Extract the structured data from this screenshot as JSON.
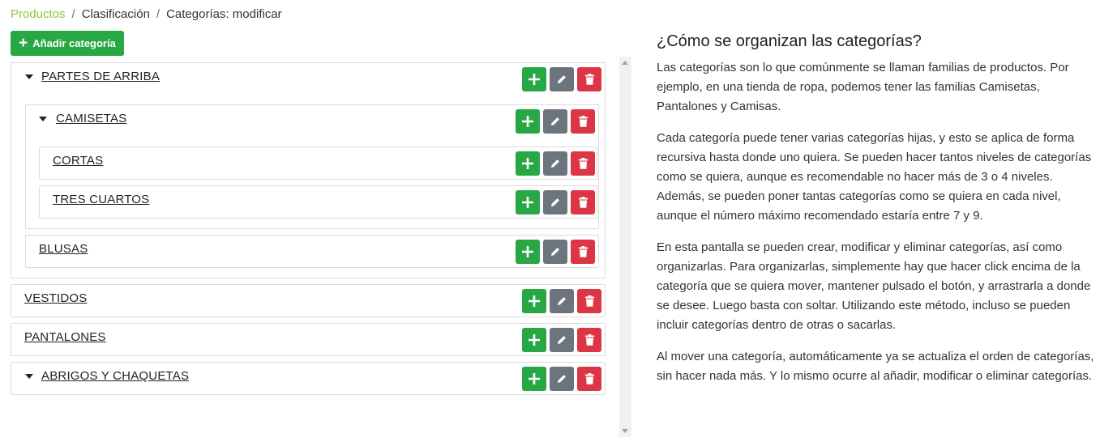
{
  "breadcrumb": {
    "items": [
      "Productos",
      "Clasificación",
      "Categorías: modificar"
    ],
    "separator": "/"
  },
  "toolbar": {
    "add_category_label": "Añadir categoría"
  },
  "tree": [
    {
      "label": "PARTES DE ARRIBA",
      "expanded": true,
      "children": [
        {
          "label": "CAMISETAS",
          "expanded": true,
          "children": [
            {
              "label": "CORTAS"
            },
            {
              "label": "TRES CUARTOS"
            }
          ]
        },
        {
          "label": "BLUSAS"
        }
      ]
    },
    {
      "label": "VESTIDOS"
    },
    {
      "label": "PANTALONES"
    },
    {
      "label": "ABRIGOS Y CHAQUETAS",
      "expanded": false
    }
  ],
  "icons": {
    "add": "plus-icon",
    "edit": "pencil-icon",
    "delete": "trash-icon",
    "expand": "caret-down-icon"
  },
  "colors": {
    "add": "#28a745",
    "edit": "#6c757d",
    "delete": "#dc3545",
    "breadcrumb_link": "#8dc63f"
  },
  "help": {
    "title": "¿Cómo se organizan las categorías?",
    "paragraphs": [
      "Las categorías son lo que comúnmente se llaman familias de productos. Por ejemplo, en una tienda de ropa, podemos tener las familias Camisetas, Pantalones y Camisas.",
      "Cada categoría puede tener varias categorías hijas, y esto se aplica de forma recursiva hasta donde uno quiera. Se pueden hacer tantos niveles de categorías como se quiera, aunque es recomendable no hacer más de 3 o 4 niveles. Además, se pueden poner tantas categorías como se quiera en cada nivel, aunque el número máximo recomendado estaría entre 7 y 9.",
      "En esta pantalla se pueden crear, modificar y eliminar categorías, así como organizarlas. Para organizarlas, simplemente hay que hacer click encima de la categoría que se quiera mover, mantener pulsado el botón, y arrastrarla a donde se desee. Luego basta con soltar. Utilizando este método, incluso se pueden incluir categorías dentro de otras o sacarlas.",
      "Al mover una categoría, automáticamente ya se actualiza el orden de categorías, sin hacer nada más. Y lo mismo ocurre al añadir, modificar o eliminar categorías."
    ]
  }
}
